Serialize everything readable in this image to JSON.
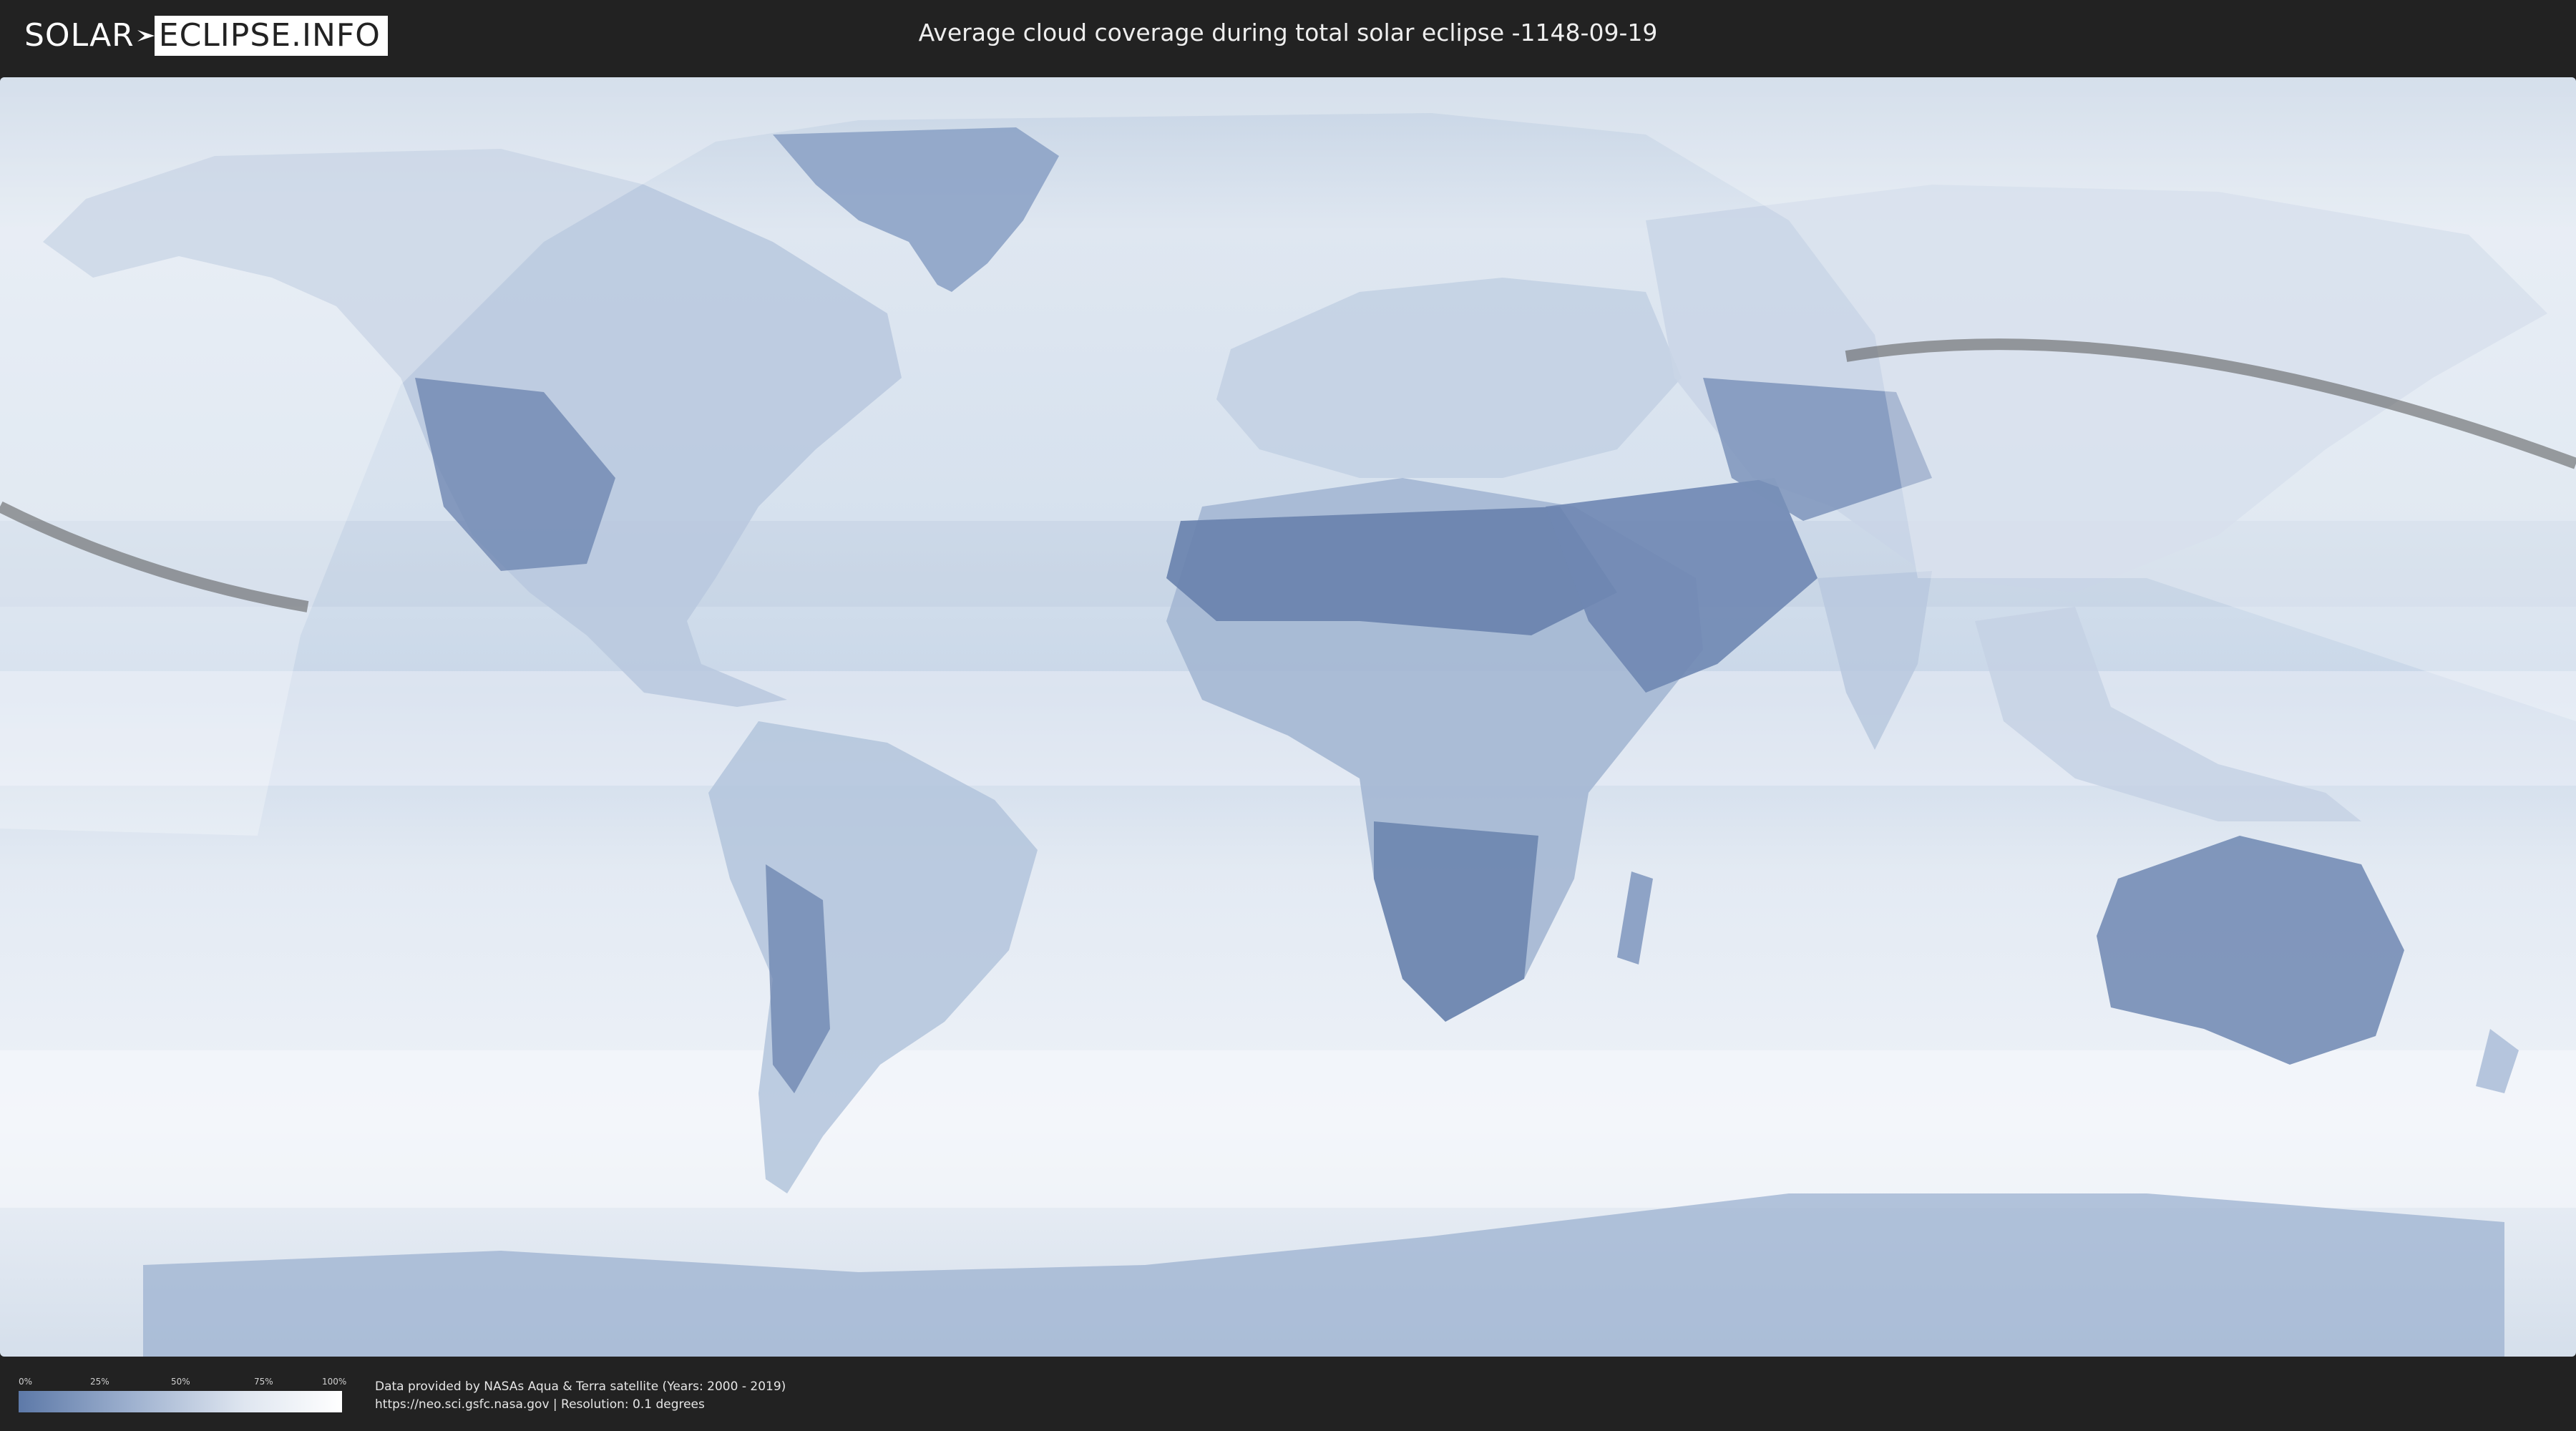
{
  "header": {
    "logo_left": "SOLAR",
    "logo_right": "ECLIPSE.INFO",
    "title": "Average cloud coverage during total solar eclipse -1148-09-19"
  },
  "legend": {
    "ticks": [
      "0%",
      "25%",
      "50%",
      "75%",
      "100%"
    ],
    "color_low": "#5d79a8",
    "color_high": "#ffffff"
  },
  "credits": {
    "line1": "Data provided by NASAs Aqua & Terra satellite (Years: 2000 - 2019)",
    "line2": "https://neo.sci.gsfc.nasa.gov | Resolution: 0.1 degrees"
  },
  "colors": {
    "background": "#222222",
    "ocean_cloud": "#dbe5f0",
    "land_clear": "#6f87b2",
    "eclipse_path": "#555555"
  }
}
